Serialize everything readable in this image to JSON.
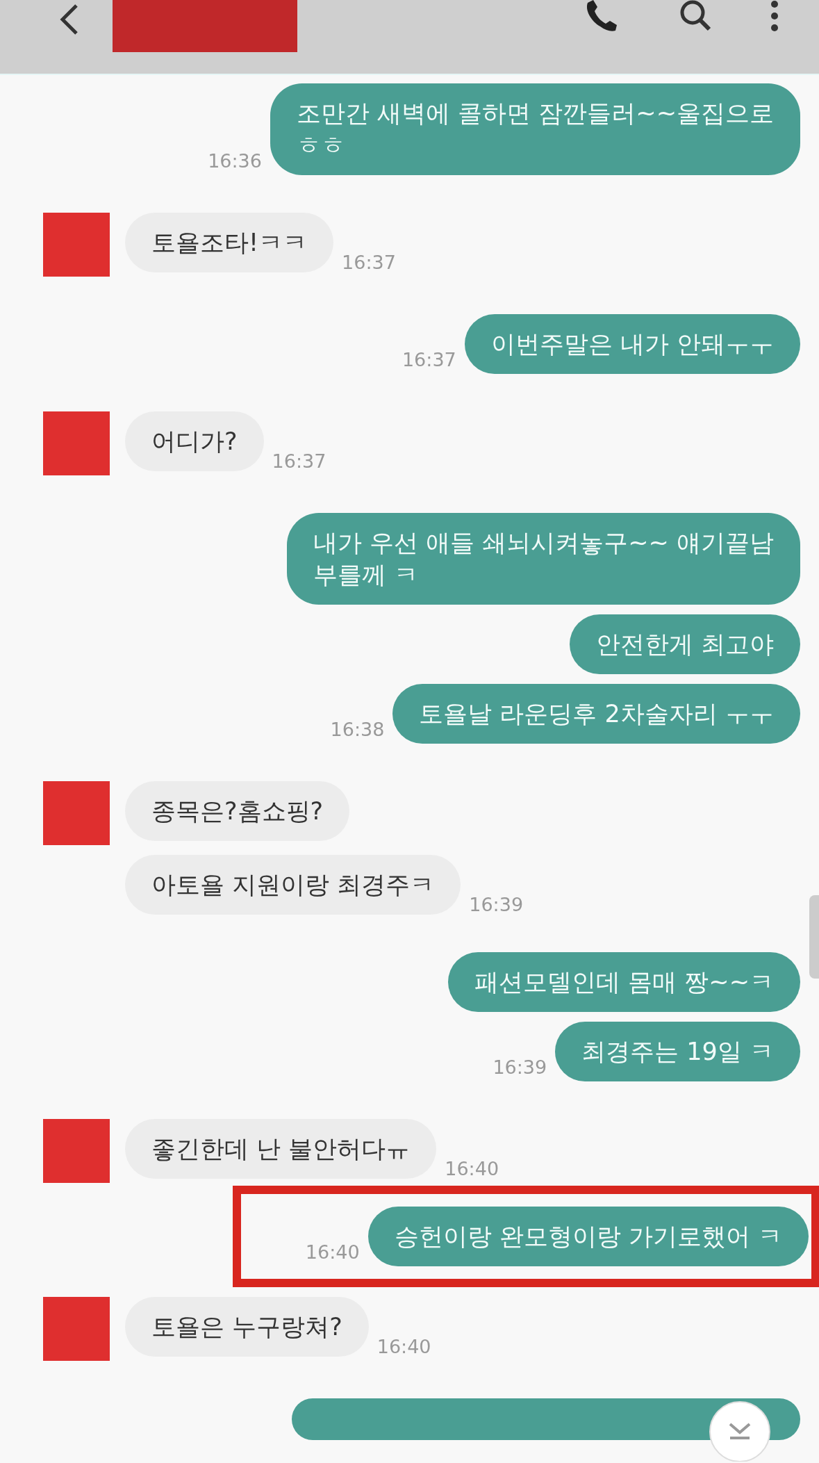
{
  "messages": [
    {
      "kind": "sent",
      "lines": [
        "조만간 새벽에 콜하면 잠깐들러~~울집으로",
        "ㅎㅎ"
      ],
      "time": "16:36",
      "highlighted": false
    },
    {
      "kind": "received",
      "avatar": true,
      "lines": [
        "토욜조타!ㅋㅋ"
      ],
      "time": "16:37",
      "highlighted": false
    },
    {
      "kind": "sent",
      "lines": [
        "이번주말은 내가 안돼ㅜㅜ"
      ],
      "time": "16:37",
      "highlighted": false
    },
    {
      "kind": "received",
      "avatar": true,
      "lines": [
        "어디가?"
      ],
      "time": "16:37",
      "highlighted": false
    },
    {
      "kind": "sent",
      "lines": [
        "내가 우선 애들  쇄뇌시켜놓구~~  얘기끝남",
        "부를께 ㅋ"
      ],
      "highlighted": false
    },
    {
      "kind": "sent",
      "lines": [
        "안전한게 최고야"
      ],
      "highlighted": false
    },
    {
      "kind": "sent",
      "lines": [
        "토욜날 라운딩후 2차술자리 ㅜㅜ"
      ],
      "time": "16:38",
      "highlighted": false
    },
    {
      "kind": "received",
      "avatar": true,
      "lines": [
        "종목은?홈쇼핑?"
      ],
      "highlighted": false
    },
    {
      "kind": "received",
      "avatar": false,
      "lines": [
        "아토욜 지원이랑 최경주ㅋ"
      ],
      "time": "16:39",
      "highlighted": false
    },
    {
      "kind": "sent",
      "lines": [
        "패션모델인데 몸매 짱~~ㅋ"
      ],
      "highlighted": false
    },
    {
      "kind": "sent",
      "lines": [
        "최경주는 19일 ㅋ"
      ],
      "time": "16:39",
      "highlighted": false
    },
    {
      "kind": "received",
      "avatar": true,
      "lines": [
        "좋긴한데 난 불안허다ㅠ"
      ],
      "time": "16:40",
      "highlighted": false
    },
    {
      "kind": "sent",
      "lines": [
        "승헌이랑 완모형이랑 가기로했어 ㅋ"
      ],
      "time": "16:40",
      "highlighted": true
    },
    {
      "kind": "received",
      "avatar": true,
      "lines": [
        "토욜은 누구랑쳐?"
      ],
      "time": "16:40",
      "highlighted": false
    }
  ],
  "partial_bubble": {
    "kind": "sent"
  }
}
